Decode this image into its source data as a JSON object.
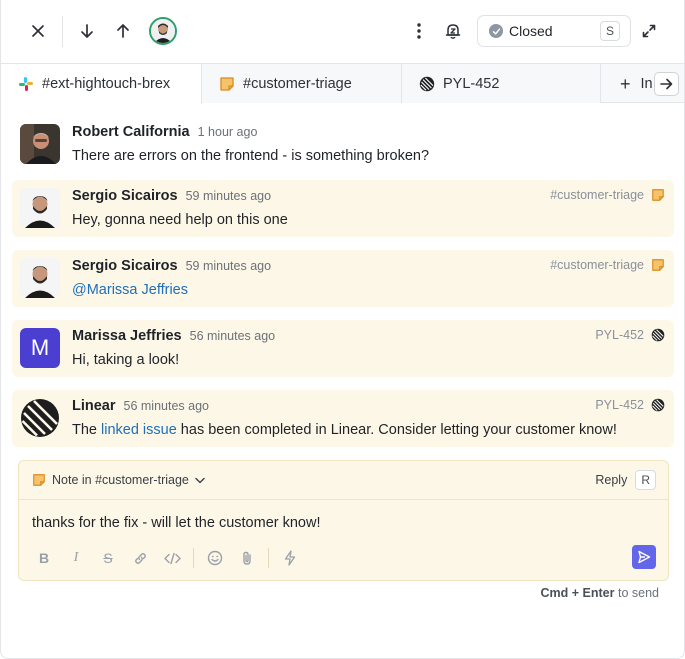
{
  "toolbar": {
    "status_label": "Closed",
    "status_shortcut": "S"
  },
  "tabs": [
    {
      "label": "#ext-hightouch-brex",
      "icon": "slack-icon"
    },
    {
      "label": "#customer-triage",
      "icon": "note-icon"
    },
    {
      "label": "PYL-452",
      "icon": "linear-icon"
    }
  ],
  "new_tab_label": "In",
  "messages": [
    {
      "author": "Robert California",
      "time": "1 hour ago",
      "text": "There are errors on the frontend - is something broken?"
    },
    {
      "author": "Sergio Sicairos",
      "time": "59 minutes ago",
      "text": "Hey, gonna need help on this one",
      "source": "#customer-triage"
    },
    {
      "author": "Sergio Sicairos",
      "time": "59 minutes ago",
      "text": "@Marissa Jeffries",
      "source": "#customer-triage"
    },
    {
      "author": "Marissa Jeffries",
      "time": "56 minutes ago",
      "text": "Hi, taking a look!",
      "source": "PYL-452",
      "avatar_letter": "M"
    },
    {
      "author": "Linear",
      "time": "56 minutes ago",
      "text_before": "The ",
      "link": "linked issue",
      "text_after": " has been completed in Linear. Consider letting your customer know!",
      "source": "PYL-452"
    }
  ],
  "composer": {
    "note_label": "Note in #customer-triage",
    "reply_label": "Reply",
    "reply_shortcut": "R",
    "text": "thanks for the fix - will let the customer know!"
  },
  "hint": {
    "keys": "Cmd + Enter",
    "suffix": "to send"
  },
  "colors": {
    "accent": "#6366e8",
    "internal_bg": "#fdf7e8",
    "link": "#1f6fb8",
    "marissa_avatar": "#4a3fd1"
  }
}
